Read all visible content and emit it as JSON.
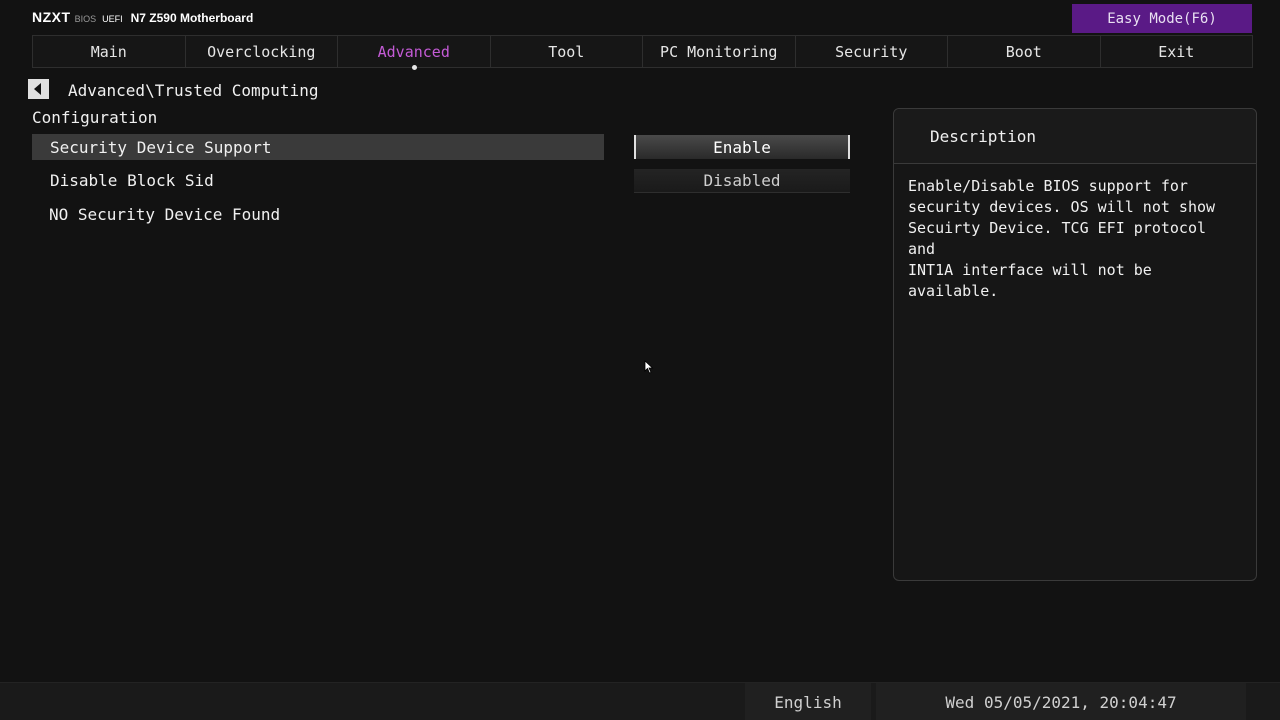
{
  "header": {
    "logo": "NZXT",
    "bios": "BIOS",
    "uefi": "UEFI",
    "model": "N7 Z590 Motherboard",
    "easy_mode": "Easy Mode(F6)"
  },
  "tabs": [
    {
      "label": "Main",
      "active": false
    },
    {
      "label": "Overclocking",
      "active": false
    },
    {
      "label": "Advanced",
      "active": true
    },
    {
      "label": "Tool",
      "active": false
    },
    {
      "label": "PC Monitoring",
      "active": false
    },
    {
      "label": "Security",
      "active": false
    },
    {
      "label": "Boot",
      "active": false
    },
    {
      "label": "Exit",
      "active": false
    }
  ],
  "breadcrumb": "Advanced\\Trusted Computing",
  "section_title": "Configuration",
  "settings": [
    {
      "label": "Security Device Support",
      "value": "Enable",
      "selected": true
    },
    {
      "label": "Disable Block Sid",
      "value": "Disabled",
      "selected": false
    },
    {
      "label": "NO Security Device Found",
      "value": null,
      "selected": false
    }
  ],
  "description": {
    "title": "Description",
    "text": "Enable/Disable BIOS support for\nsecurity devices. OS will not show\nSecuirty Device. TCG EFI protocol and\nINT1A interface will not be available."
  },
  "footer": {
    "language": "English",
    "datetime": "Wed 05/05/2021, 20:04:47"
  },
  "colors": {
    "accent": "#c45bd6",
    "easy_mode_bg": "#5a1a86",
    "background": "#121212"
  }
}
